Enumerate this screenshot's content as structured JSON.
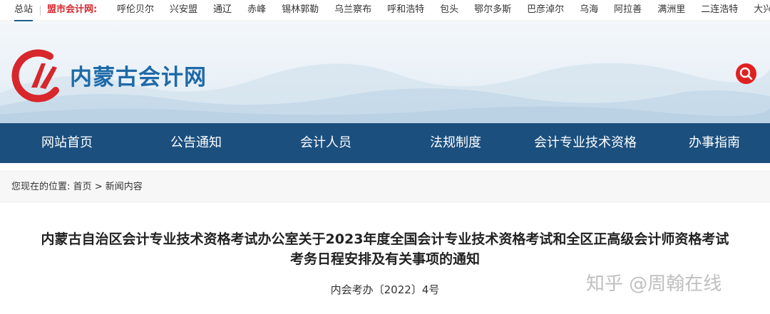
{
  "topbar": {
    "home": "总站",
    "label": "盟市会计网:",
    "cities": [
      "呼伦贝尔",
      "兴安盟",
      "通辽",
      "赤峰",
      "锡林郭勒",
      "乌兰察布",
      "呼和浩特",
      "包头",
      "鄂尔多斯",
      "巴彦淖尔",
      "乌海",
      "阿拉善",
      "满洲里",
      "二连浩特",
      "大兴安岭"
    ]
  },
  "header": {
    "site_name": "内蒙古会计网",
    "search_icon": "search-icon",
    "brand_color": "#1e6aa8",
    "accent_color": "#e02020"
  },
  "nav": {
    "items": [
      "网站首页",
      "公告通知",
      "会计人员",
      "法规制度",
      "会计专业技术资格",
      "办事指南"
    ],
    "background": "#1b4f7e"
  },
  "breadcrumb": {
    "prefix": "您现在的位置:",
    "home": "首页",
    "separator": ">",
    "current": "新闻内容"
  },
  "article": {
    "title_line1": "内蒙古自治区会计专业技术资格考试办公室关于2023年度全国会计专业技术资格考试和全区正高级会计师资格考试",
    "title_line2": "考务日程安排及有关事项的通知",
    "doc_number": "内会考办〔2022〕4号"
  },
  "watermark": "知乎 @周翰在线"
}
